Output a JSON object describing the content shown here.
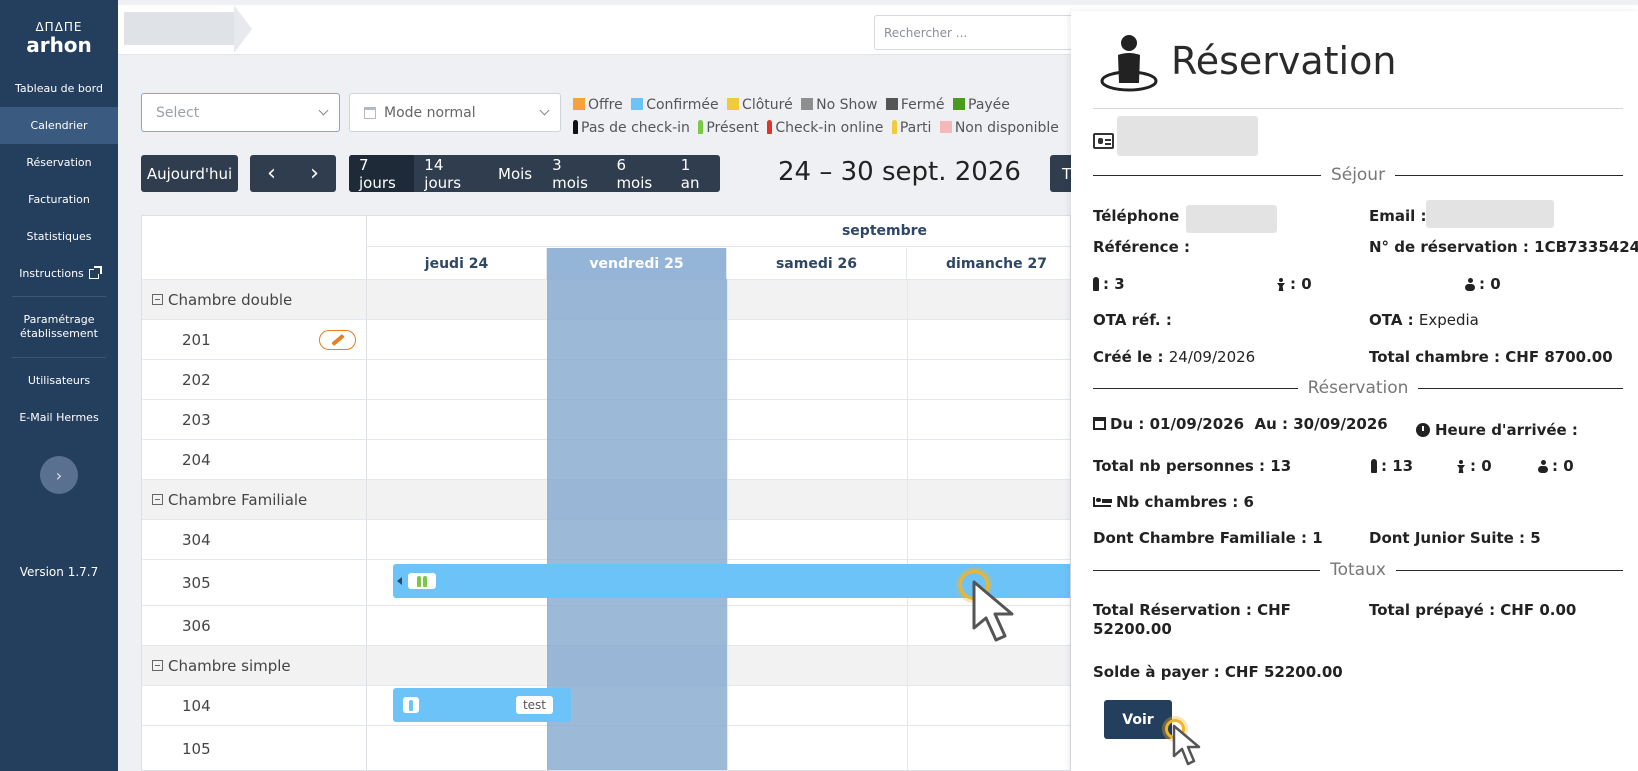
{
  "sidebar": {
    "logo_mark": "ΔΠΔΠΕ",
    "logo_text": "arhon",
    "items": [
      {
        "label": "Tableau de bord"
      },
      {
        "label": "Calendrier"
      },
      {
        "label": "Réservation"
      },
      {
        "label": "Facturation"
      },
      {
        "label": "Statistiques"
      },
      {
        "label": "Instructions"
      },
      {
        "label": "Paramétrage établissement"
      },
      {
        "label": "Utilisateurs"
      },
      {
        "label": "E-Mail Hermes"
      }
    ],
    "collapse_icon": "chevron-right-icon",
    "version": "Version 1.7.7"
  },
  "topbar": {
    "search_placeholder": "Rechercher ..."
  },
  "controls": {
    "select_placeholder": "Select",
    "mode_value": "Mode normal",
    "legend": [
      {
        "label": "Offre",
        "color": "#f7a23b"
      },
      {
        "label": "Confirmée",
        "color": "#6cc3f7"
      },
      {
        "label": "Clôturé",
        "color": "#f2cb3b"
      },
      {
        "label": "No Show",
        "color": "#8e8e8e"
      },
      {
        "label": "Fermé",
        "color": "#555555"
      },
      {
        "label": "Payée",
        "color": "#4a9a1e"
      }
    ],
    "legend2": [
      {
        "label": "Pas de check-in",
        "color": "#111111"
      },
      {
        "label": "Présent",
        "color": "#7ac943"
      },
      {
        "label": "Check-in online",
        "color": "#d9382b"
      },
      {
        "label": "Parti",
        "color": "#f2cb3b"
      },
      {
        "label": "Non disponible",
        "color": "#f4b8b8"
      }
    ],
    "today": "Aujourd'hui",
    "prev_icon": "chevron-left-icon",
    "next_icon": "chevron-right-icon",
    "ranges": [
      "7 jours",
      "14 jours",
      "Mois",
      "3 mois",
      "6 mois",
      "1 an"
    ],
    "active_range": "7 jours",
    "date_title": "24 – 30 sept. 2026",
    "right_button": "T"
  },
  "calendar": {
    "month": "septembre",
    "days": [
      "jeudi 24",
      "vendredi 25",
      "samedi 26",
      "dimanche 27"
    ],
    "rows": [
      {
        "type": "group",
        "label": "Chambre double"
      },
      {
        "type": "room",
        "label": "201"
      },
      {
        "type": "room",
        "label": "202"
      },
      {
        "type": "room",
        "label": "203"
      },
      {
        "type": "room",
        "label": "204"
      },
      {
        "type": "group",
        "label": "Chambre Familiale"
      },
      {
        "type": "room",
        "label": "304"
      },
      {
        "type": "room",
        "label": "305"
      },
      {
        "type": "room",
        "label": "306"
      },
      {
        "type": "group",
        "label": "Chambre simple"
      },
      {
        "type": "room",
        "label": "104"
      },
      {
        "type": "room",
        "label": "105"
      }
    ],
    "booking_tag": "test"
  },
  "panel": {
    "title": "Réservation",
    "section_sejour": "Séjour",
    "telephone_label": "Téléphone :",
    "email_label": "Email :",
    "reference_label": "Référence :",
    "numero_label": "N° de réservation :",
    "numero_value": "1CB7335424",
    "adults": ": 3",
    "children": ": 0",
    "babies": ": 0",
    "ota_ref_label": "OTA réf. :",
    "ota_label": "OTA :",
    "ota_value": "Expedia",
    "cree_label": "Créé le :",
    "cree_value": "24/09/2026",
    "total_chambre_label": "Total chambre :",
    "total_chambre_value": "CHF 8700.00",
    "section_reservation": "Réservation",
    "du_label": "Du :",
    "du_value": "01/09/2026",
    "au_label": "Au :",
    "au_value": "30/09/2026",
    "heure_label": "Heure d'arrivée :",
    "total_personnes_label": "Total nb personnes :",
    "total_personnes_value": "13",
    "res_adults": ": 13",
    "res_children": ": 0",
    "res_babies": ": 0",
    "nb_chambres_label": "Nb chambres :",
    "nb_chambres_value": "6",
    "dont_familiale": "Dont Chambre Familiale : 1",
    "dont_junior": "Dont Junior Suite : 5",
    "section_totaux": "Totaux",
    "total_reservation_line1": "Total Réservation : CHF",
    "total_reservation_line2": "52200.00",
    "total_prepaye": "Total prépayé : CHF 0.00",
    "solde": "Solde à payer : CHF 52200.00",
    "voir": "Voir"
  }
}
